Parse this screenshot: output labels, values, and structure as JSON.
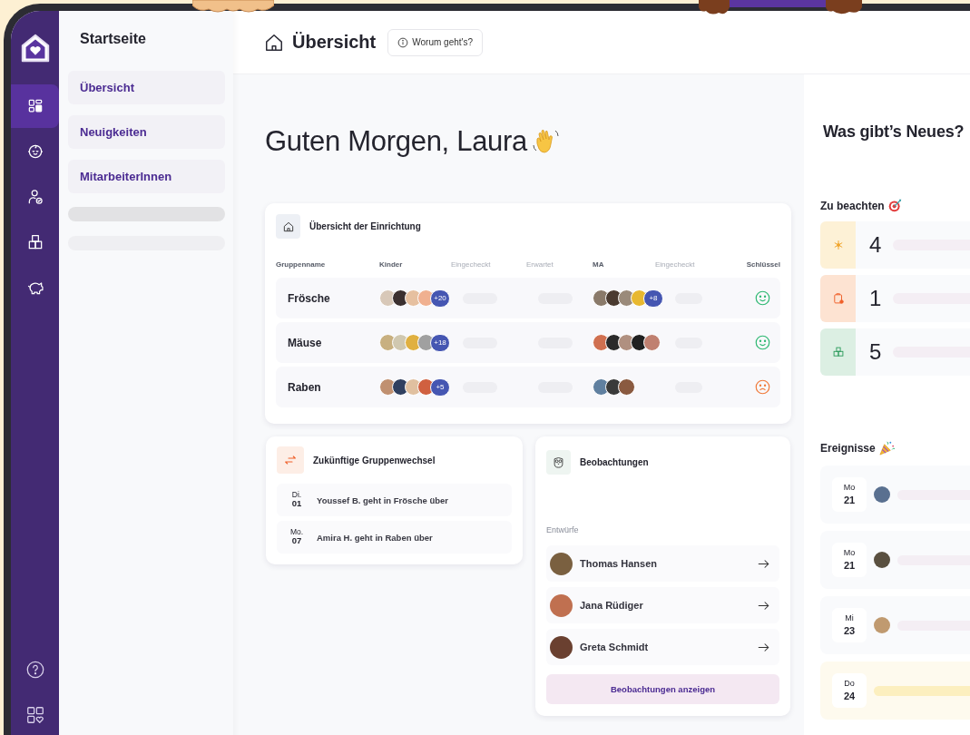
{
  "rail": {
    "items": [
      {
        "kind": "dashboard",
        "selected": true
      },
      {
        "kind": "baby",
        "selected": false
      },
      {
        "kind": "person-check",
        "selected": false
      },
      {
        "kind": "blocks",
        "selected": false
      },
      {
        "kind": "piggy-bank",
        "selected": false
      }
    ],
    "bottom_items": [
      {
        "kind": "help"
      },
      {
        "kind": "apps"
      }
    ]
  },
  "sidebar": {
    "title": "Startseite",
    "items": [
      {
        "label": "Übersicht"
      },
      {
        "label": "Neuigkeiten"
      },
      {
        "label": "MitarbeiterInnen"
      }
    ]
  },
  "header": {
    "title": "Übersicht",
    "help_button": "Worum geht's?"
  },
  "greeting": "Guten Morgen, Laura",
  "facility": {
    "title": "Übersicht der Einrichtung",
    "columns": [
      {
        "label": "Gruppenname",
        "muted": false
      },
      {
        "label": "Kinder",
        "muted": false
      },
      {
        "label": "Eingecheckt",
        "muted": true
      },
      {
        "label": "Erwartet",
        "muted": true
      },
      {
        "label": "MA",
        "muted": false
      },
      {
        "label": "Eingecheckt",
        "muted": true
      },
      {
        "label": "Schlüssel",
        "muted": false
      }
    ],
    "rows": [
      {
        "name": "Frösche",
        "kid_photos": [
          {
            "color": "#d8c8b8"
          },
          {
            "color": "#3b3030"
          },
          {
            "color": "#e6c0a0"
          },
          {
            "color": "#f0b090"
          }
        ],
        "kids_more": "+20",
        "staff_photos": [
          {
            "color": "#8a7a6a"
          },
          {
            "color": "#4a3a30"
          },
          {
            "color": "#9a8a7a"
          },
          {
            "color": "#e8b830"
          }
        ],
        "staff_more": "+8",
        "key_present": true
      },
      {
        "name": "Mäuse",
        "kid_photos": [
          {
            "color": "#c8b080"
          },
          {
            "color": "#d0c8b0"
          },
          {
            "color": "#e0b040"
          },
          {
            "color": "#a0a0a0"
          }
        ],
        "kids_more": "+18",
        "staff_photos": [
          {
            "color": "#d07050"
          },
          {
            "color": "#2a2a2a"
          },
          {
            "color": "#b09080"
          },
          {
            "color": "#202020"
          },
          {
            "color": "#c08070"
          }
        ],
        "key_present": true
      },
      {
        "name": "Raben",
        "kid_photos": [
          {
            "color": "#c09070"
          },
          {
            "color": "#304060"
          },
          {
            "color": "#e0c0a0"
          },
          {
            "color": "#d06040"
          }
        ],
        "kids_more": "+5",
        "staff_photos": [
          {
            "color": "#6080a0"
          },
          {
            "color": "#3a3a3a"
          },
          {
            "color": "#8a5a40"
          }
        ],
        "key_present": false
      }
    ]
  },
  "group_changes": {
    "title": "Zukünftige Gruppenwechsel",
    "items": [
      {
        "weekday": "Di.",
        "day": "01",
        "text": "Youssef B. geht in Frösche über"
      },
      {
        "weekday": "Mo.",
        "day": "07",
        "text": "Amira H. geht in Raben über"
      }
    ]
  },
  "observations": {
    "title": "Beobachtungen",
    "section": "Entwürfe",
    "drafts": [
      {
        "name": "Thomas Hansen",
        "color": "#7a6040"
      },
      {
        "name": "Jana Rüdiger",
        "color": "#c07050"
      },
      {
        "name": "Greta Schmidt",
        "color": "#6a4030"
      }
    ],
    "button": "Beobachtungen anzeigen"
  },
  "news": {
    "title": "Was gibt’s Neues?",
    "notices": {
      "title": "Zu beachten",
      "items": [
        {
          "kind": "asterisk",
          "color": "#fdf1d6",
          "count": "4"
        },
        {
          "kind": "clipboard",
          "color": "#fde3d2",
          "count": "1"
        },
        {
          "kind": "blocks",
          "color": "#dcefe3",
          "count": "5"
        }
      ]
    },
    "events": {
      "title": "Ereignisse",
      "items": [
        {
          "weekday": "Mo",
          "day": "21",
          "color": "#5a7090",
          "highlighted": false
        },
        {
          "weekday": "Mo",
          "day": "21",
          "color": "#5a5040",
          "highlighted": false
        },
        {
          "weekday": "Mi",
          "day": "23",
          "color": "#c09a70",
          "highlighted": false
        },
        {
          "weekday": "Do",
          "day": "24",
          "highlighted": true
        }
      ]
    }
  }
}
